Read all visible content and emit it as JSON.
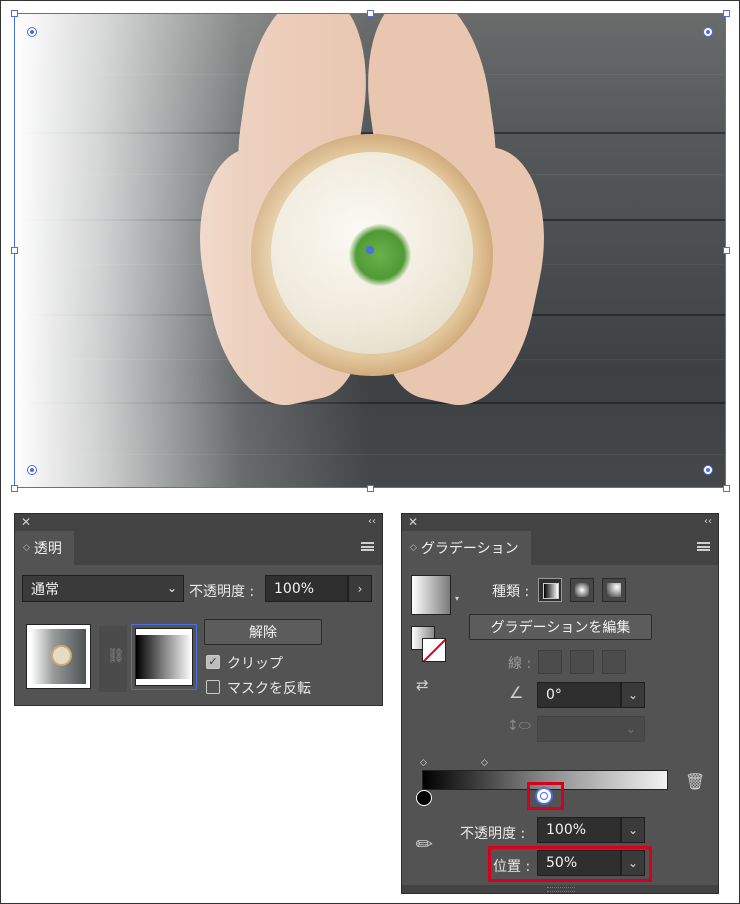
{
  "transparency_panel": {
    "tab_label": "透明",
    "blend_mode": "通常",
    "opacity_label": "不透明度 :",
    "opacity_value": "100%",
    "release_button": "解除",
    "clip_label": "クリップ",
    "clip_checked": true,
    "invert_mask_label": "マスクを反転",
    "invert_mask_checked": false
  },
  "gradient_panel": {
    "tab_label": "グラデーション",
    "type_label": "種類 :",
    "edit_button": "グラデーションを編集",
    "stroke_label": "線 :",
    "angle_value": "0°",
    "opacity_label": "不透明度 :",
    "opacity_value": "100%",
    "location_label": "位置 :",
    "location_value": "50%",
    "midpoint_location": 0.5
  },
  "colors": {
    "selection": "#4a6fe0",
    "highlight": "#d6001c",
    "panel_bg": "#535353"
  },
  "icons": [
    "close-icon",
    "collapse-icon",
    "panel-menu-icon",
    "chevron-down-icon",
    "link-icon",
    "eyedropper-icon",
    "trash-icon",
    "angle-icon",
    "aspect-ratio-icon",
    "linear-gradient-icon",
    "radial-gradient-icon",
    "freeform-gradient-icon"
  ]
}
